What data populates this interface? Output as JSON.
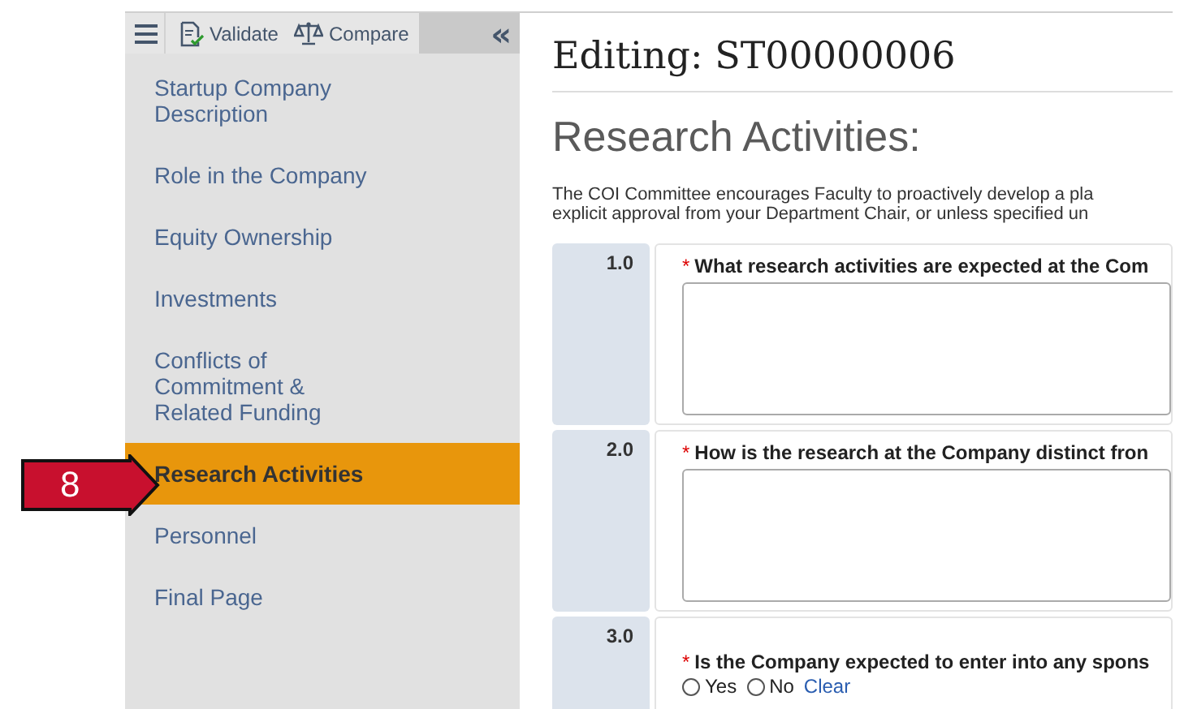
{
  "toolbar": {
    "buttons": [
      {
        "kind": "menu"
      },
      {
        "kind": "validate",
        "label": "Validate"
      },
      {
        "kind": "compare",
        "label": "Compare"
      }
    ],
    "collapse": "«"
  },
  "sidebar": {
    "items": [
      {
        "label": "Startup Company\nDescription",
        "selected": false
      },
      {
        "label": "Role in the Company",
        "selected": false
      },
      {
        "label": "Equity Ownership",
        "selected": false
      },
      {
        "label": "Investments",
        "selected": false
      },
      {
        "label": "Conflicts of\nCommitment &\nRelated Funding",
        "selected": false
      },
      {
        "label": "Research Activities",
        "selected": true
      },
      {
        "label": "Personnel",
        "selected": false
      },
      {
        "label": "Final Page",
        "selected": false
      }
    ]
  },
  "callout": {
    "label": "8"
  },
  "main": {
    "title": "Editing: ST00000006",
    "heading": "Research Activities:",
    "description": [
      "The COI Committee encourages Faculty to proactively develop a pla",
      "explicit approval from your Department Chair, or unless specified un"
    ],
    "questions": [
      {
        "number": "1.0",
        "kind": "text",
        "marker": "*",
        "text": "What research activities are expected at the Com"
      },
      {
        "number": "2.0",
        "kind": "text",
        "marker": "*",
        "text": "How is the research at the Company distinct fron"
      },
      {
        "number": "3.0",
        "kind": "radio",
        "marker": "*",
        "text": "Is the Company expected to enter into any spons",
        "options": [
          {
            "label": "Yes",
            "selected": false
          },
          {
            "label": "No",
            "selected": false
          }
        ],
        "clear": "Clear"
      }
    ]
  }
}
